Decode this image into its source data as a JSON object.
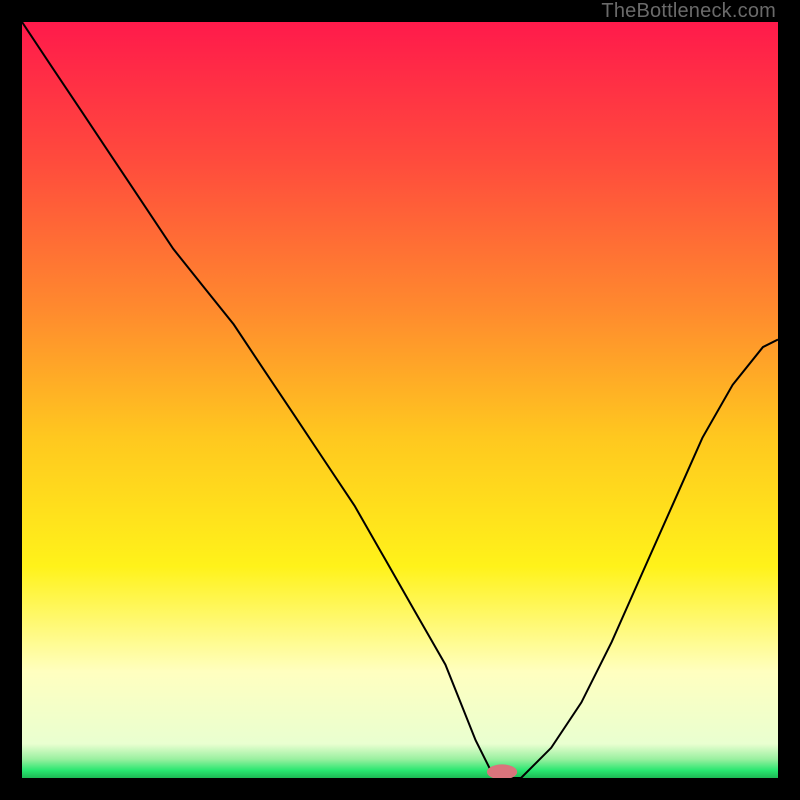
{
  "watermark": "TheBottleneck.com",
  "chart_data": {
    "type": "line",
    "title": "",
    "xlabel": "",
    "ylabel": "",
    "xlim": [
      0,
      100
    ],
    "ylim": [
      0,
      100
    ],
    "grid": false,
    "legend": false,
    "background": {
      "description": "vertical spectrum red→orange→yellow→pale-yellow→green with thin bright-green baseline",
      "stops": [
        {
          "offset": 0.0,
          "color": "#ff1a4b"
        },
        {
          "offset": 0.18,
          "color": "#ff4a3d"
        },
        {
          "offset": 0.38,
          "color": "#ff8a2e"
        },
        {
          "offset": 0.55,
          "color": "#ffc81f"
        },
        {
          "offset": 0.72,
          "color": "#fff21a"
        },
        {
          "offset": 0.86,
          "color": "#ffffc0"
        },
        {
          "offset": 0.955,
          "color": "#e9ffd0"
        },
        {
          "offset": 0.975,
          "color": "#9af0a0"
        },
        {
          "offset": 0.99,
          "color": "#28e770"
        },
        {
          "offset": 1.0,
          "color": "#1db954"
        }
      ]
    },
    "series": [
      {
        "name": "bottleneck-curve",
        "color": "#000000",
        "stroke_width": 2,
        "x": [
          0,
          4,
          8,
          12,
          16,
          20,
          24,
          28,
          32,
          36,
          40,
          44,
          48,
          52,
          56,
          58,
          60,
          62,
          64,
          66,
          70,
          74,
          78,
          82,
          86,
          90,
          94,
          98,
          100
        ],
        "y": [
          100,
          94,
          88,
          82,
          76,
          70,
          65,
          60,
          54,
          48,
          42,
          36,
          29,
          22,
          15,
          10,
          5,
          1,
          0,
          0,
          4,
          10,
          18,
          27,
          36,
          45,
          52,
          57,
          58
        ]
      }
    ],
    "marker": {
      "name": "optimal-point",
      "x": 63.5,
      "y": 0.8,
      "rx": 2.0,
      "ry": 1.0,
      "fill": "#d9747c"
    }
  }
}
